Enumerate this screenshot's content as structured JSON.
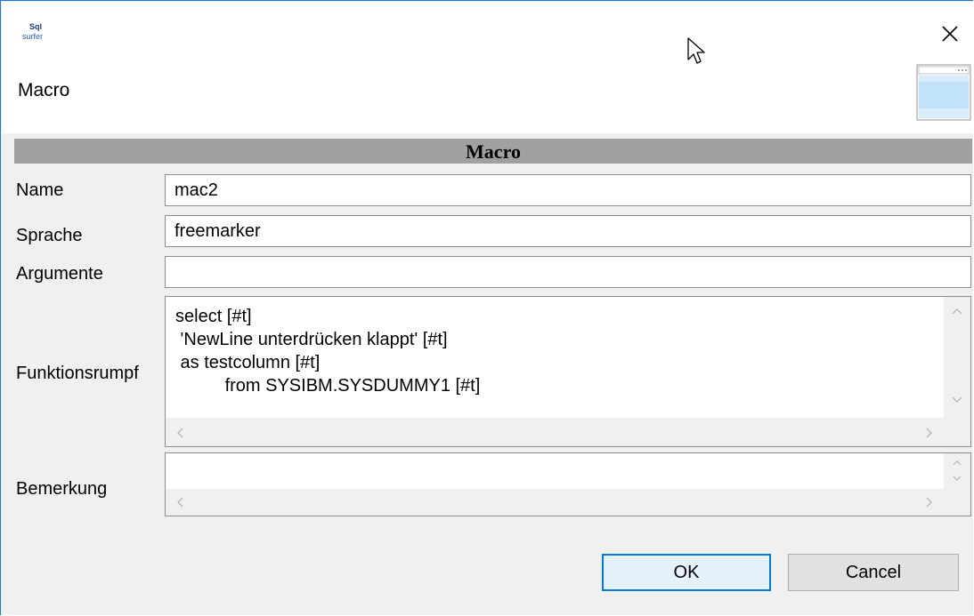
{
  "window": {
    "title": "Macro",
    "logo_text_top": "Sql",
    "logo_text_bottom": "surfer",
    "close_icon": "close-icon"
  },
  "section": {
    "title": "Macro"
  },
  "form": {
    "name": {
      "label": "Name",
      "value": "mac2"
    },
    "language": {
      "label": "Sprache",
      "value": "freemarker"
    },
    "arguments": {
      "label": "Argumente",
      "value": ""
    },
    "body": {
      "label": "Funktionsrumpf",
      "lines": [
        "select [#t]",
        " 'NewLine unterdrücken klappt' [#t]",
        " as testcolumn [#t]",
        "          from SYSIBM.SYSDUMMY1 [#t]"
      ]
    },
    "remark": {
      "label": "Bemerkung",
      "value": ""
    }
  },
  "buttons": {
    "ok": "OK",
    "cancel": "Cancel"
  },
  "colors": {
    "accent": "#0078d7",
    "section_bar": "#a0a0a0",
    "window_border": "#1979ca",
    "background": "#f0f0f0"
  }
}
